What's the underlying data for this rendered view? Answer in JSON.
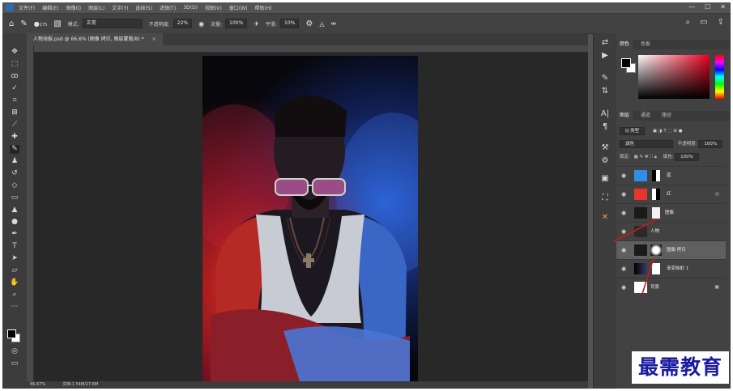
{
  "menubar": {
    "items": [
      "文件(F)",
      "编辑(E)",
      "图像(I)",
      "图层(L)",
      "文字(Y)",
      "选择(S)",
      "滤镜(T)",
      "3D(D)",
      "视图(V)",
      "窗口(W)",
      "帮助(H)"
    ],
    "window_controls": [
      "—",
      "☐",
      "✕"
    ]
  },
  "options_bar": {
    "brush_size": "175",
    "mode_label": "模式:",
    "mode_value": "正常",
    "opacity_label": "不透明度:",
    "opacity_value": "22%",
    "flow_label": "流量:",
    "flow_value": "100%",
    "smoothing_label": "平滑:",
    "smoothing_value": "10%"
  },
  "document": {
    "tab_title": "人物海报.psd @ 66.6% (图像 拷贝, 图层蒙版/8) *",
    "tab_close": "×",
    "zoom": "66.67%",
    "doc_info": "文档:1.54M/27.6M"
  },
  "panels": {
    "color_tabs": [
      "颜色",
      "色板"
    ],
    "layers_tabs": [
      "图层",
      "通道",
      "路径"
    ],
    "kind_filter": "Q 类型",
    "blend_mode": "滤色",
    "opacity_label": "不透明度:",
    "opacity_value": "100%",
    "lock_label": "锁定:",
    "fill_label": "填充:",
    "fill_value": "100%",
    "layers": [
      {
        "name": "蓝",
        "thumb_color": "#2f8ee8",
        "selected": false
      },
      {
        "name": "红",
        "thumb_color": "#e8342f",
        "selected": false
      },
      {
        "name": "图像",
        "thumb_color": "#1a1a1a",
        "selected": false
      },
      {
        "name": "人物",
        "thumb_color": "#2a2a2a",
        "selected": false
      },
      {
        "name": "图像 拷贝",
        "thumb_color": "#1a1a1a",
        "selected": true
      },
      {
        "name": "渐变映射 1",
        "thumb_color": "#101010",
        "selected": false
      },
      {
        "name": "背景",
        "thumb_color": "#ffffff",
        "selected": false
      }
    ]
  },
  "watermark": "最需教育",
  "colors": {
    "accent_arrow": "#d01818",
    "watermark": "#1a1aa0"
  }
}
